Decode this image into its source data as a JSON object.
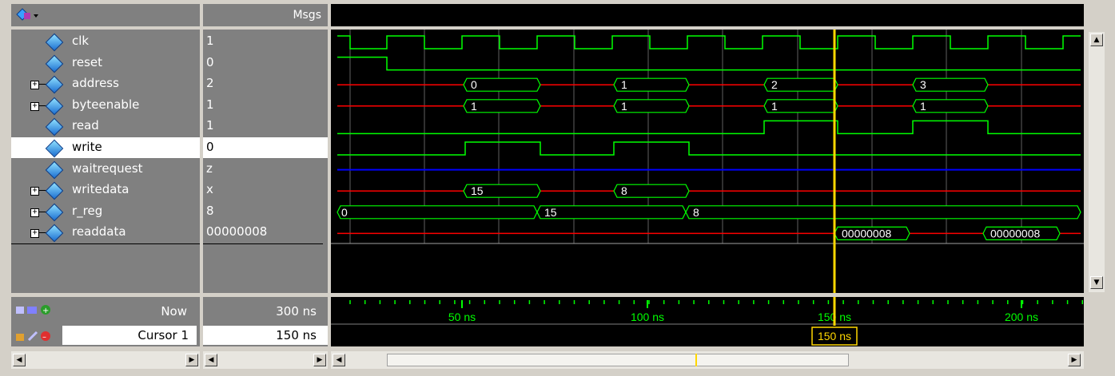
{
  "header": {
    "msgs_label": "Msgs"
  },
  "signals": [
    {
      "name": "clk",
      "value": "1",
      "expandable": false
    },
    {
      "name": "reset",
      "value": "0",
      "expandable": false
    },
    {
      "name": "address",
      "value": "2",
      "expandable": true
    },
    {
      "name": "byteenable",
      "value": "1",
      "expandable": true
    },
    {
      "name": "read",
      "value": "1",
      "expandable": false
    },
    {
      "name": "write",
      "value": "0",
      "expandable": false
    },
    {
      "name": "waitrequest",
      "value": "z",
      "expandable": false
    },
    {
      "name": "writedata",
      "value": "x",
      "expandable": true
    },
    {
      "name": "r_reg",
      "value": "8",
      "expandable": true
    },
    {
      "name": "readdata",
      "value": "00000008",
      "expandable": true
    }
  ],
  "selected_signal": "write",
  "waveform": {
    "bus_values": {
      "address": [
        "0",
        "1",
        "2",
        "3"
      ],
      "byteenable": [
        "1",
        "1",
        "1",
        "1"
      ],
      "writedata": [
        "15",
        "8"
      ],
      "r_reg": [
        "0",
        "15",
        "8"
      ],
      "readdata": [
        "00000008",
        "00000008"
      ]
    },
    "time_axis": [
      "50 ns",
      "100 ns",
      "150 ns",
      "200 ns"
    ]
  },
  "footer": {
    "now_label": "Now",
    "now_value": "300 ns",
    "cursor_name": "Cursor 1",
    "cursor_value": "150 ns",
    "cursor_marker": "150 ns"
  },
  "colors": {
    "signal_green": "#00ff00",
    "bus_red": "#ff0000",
    "z_blue": "#0000ff",
    "cursor_yellow": "#ffd700"
  }
}
